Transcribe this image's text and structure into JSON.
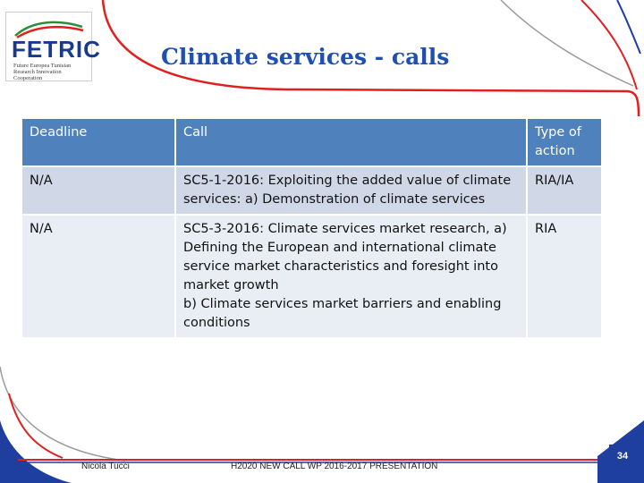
{
  "logo": {
    "word": "FETRIC",
    "tagline": "Future Europea Tunisian Research Innovation Cooperation"
  },
  "slide": {
    "title": "Climate services - calls",
    "page_number": "34"
  },
  "table": {
    "headers": [
      "Deadline",
      "Call",
      "Type of action"
    ],
    "rows": [
      {
        "deadline": "N/A",
        "call": "SC5-1-2016: Exploiting the added value of climate services: a) Demonstration of climate services",
        "type": "RIA/IA"
      },
      {
        "deadline": "N/A",
        "call": "SC5-3-2016: Climate services market research, a) Defining the European and international climate service market characteristics and foresight into market growth\nb) Climate services market barriers and enabling conditions",
        "type": "RIA"
      }
    ]
  },
  "footer": {
    "author": "Nicola Tucci",
    "center": "H2020 NEW CALL WP 2016-2017 PRESENTATION"
  },
  "colors": {
    "header_fill": "#4f81bd",
    "row1_fill": "#d0d8e8",
    "row2_fill": "#e9edf4",
    "title_blue": "#1f4fb4",
    "accent_red": "#e02020",
    "accent_navy": "#1f3fa0"
  }
}
